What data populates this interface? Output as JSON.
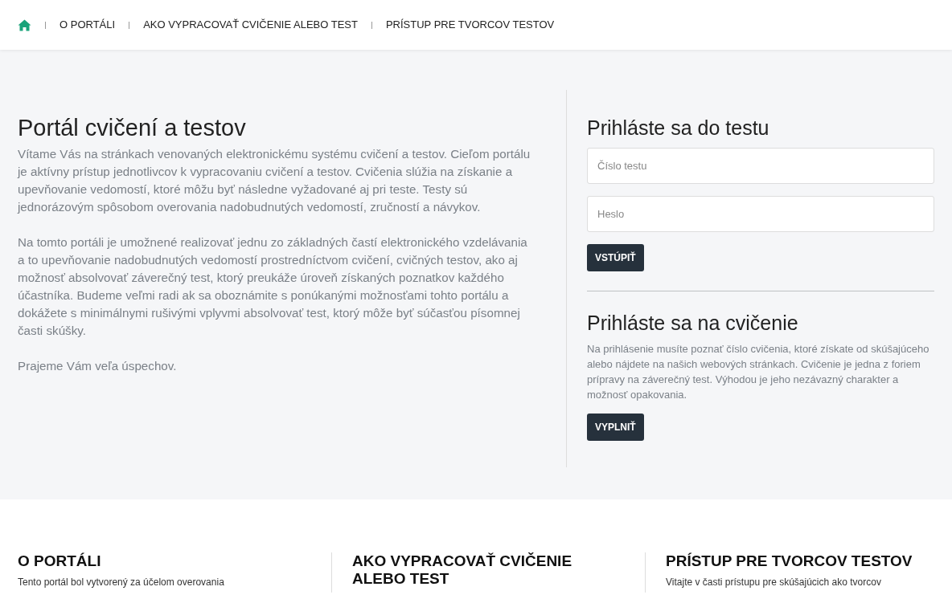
{
  "nav": {
    "items": [
      {
        "kind": "home"
      },
      {
        "kind": "link",
        "label": "O PORTÁLI"
      },
      {
        "kind": "link",
        "label": "AKO VYPRACOVAŤ CVIČENIE ALEBO TEST"
      },
      {
        "kind": "link",
        "label": "PRÍSTUP PRE TVORCOV TESTOV"
      }
    ]
  },
  "intro": {
    "title": "Portál cvičení a testov",
    "paragraphs": [
      "Vítame Vás na stránkach venovaných elektronickému systému cvičení a testov. Cieľom portálu je aktívny prístup jednotlivcov k vypracovaniu cvičení a testov. Cvičenia slúžia na získanie a upevňovanie vedomostí, ktoré môžu byť následne vyžadované aj pri teste. Testy sú jednorázovým spôsobom overovania nadobudnutých vedomostí, zručností a návykov.",
      "Na tomto portáli je umožnené realizovať jednu zo základných častí elektronického vzdelávania a to upevňovanie nadobudnutých vedomostí prostredníctvom cvičení, cvičných testov, ako aj možnosť absolvovať záverečný test, ktorý preukáže úroveň získaných poznatkov každého účastníka. Budeme veľmi radi ak sa oboznámite s ponúkanými možnosťami tohto portálu a dokážete s minimálnymi rušivými vplyvmi absolvovať test, ktorý môže byť súčasťou písomnej časti skúšky.",
      "Prajeme Vám veľa úspechov."
    ]
  },
  "test_login": {
    "title": "Prihláste sa do testu",
    "fields": [
      {
        "placeholder": "Číslo testu"
      },
      {
        "placeholder": "Heslo"
      }
    ],
    "button": "VSTÚPIŤ"
  },
  "exercise_login": {
    "title": "Prihláste sa na cvičenie",
    "text": "Na prihlásenie musíte poznať číslo cvičenia, ktoré získate od skúšajúceho alebo nájdete na našich webových stránkach. Cvičenie je jedna z foriem prípravy na záverečný test. Výhodou je jeho nezávazný charakter a možnosť opakovania.",
    "button": "VYPLNIŤ"
  },
  "footer_columns": [
    {
      "title": "O PORTÁLI",
      "text": "Tento portál bol vytvorený za účelom overovania"
    },
    {
      "title": "AKO VYPRACOVAŤ CVIČENIE ALEBO TEST"
    },
    {
      "title": "PRÍSTUP PRE TVORCOV TESTOV",
      "text": "Vitajte v časti prístupu pre skúšajúcich ako tvorcov"
    }
  ]
}
